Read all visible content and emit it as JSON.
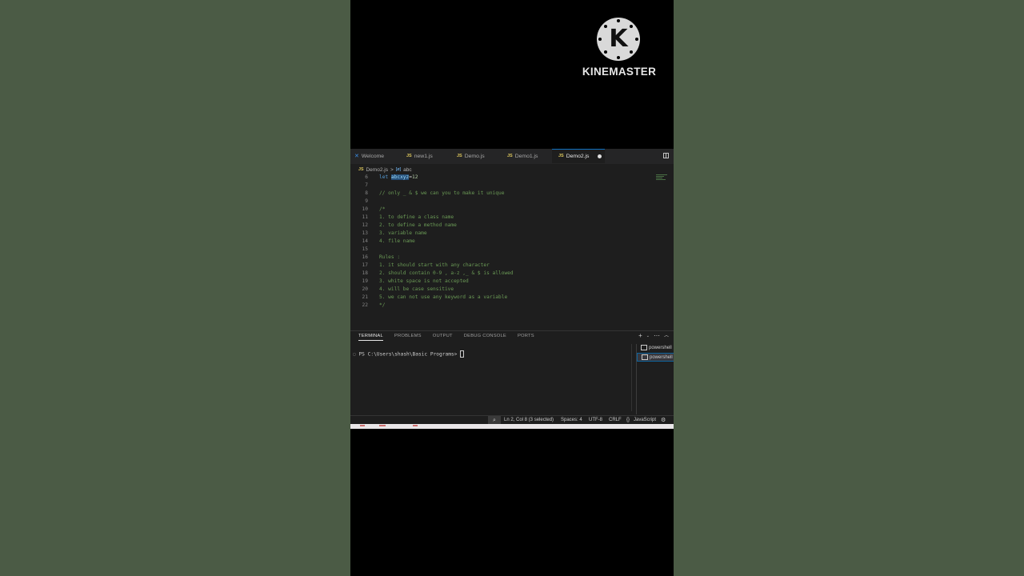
{
  "watermark": {
    "brand": "KINEMASTER",
    "logo_letter": "K"
  },
  "tabs": [
    {
      "icon": "vscode-icon",
      "label": "Welcome",
      "active": false
    },
    {
      "icon": "JS",
      "label": "new1.js",
      "active": false
    },
    {
      "icon": "JS",
      "label": "Demo.js",
      "active": false
    },
    {
      "icon": "JS",
      "label": "Demo1.js",
      "active": false
    },
    {
      "icon": "JS",
      "label": "Demo2.js",
      "active": true,
      "modified": true
    }
  ],
  "breadcrumb": {
    "file": "Demo2.js",
    "sep": ">",
    "symbol_icon": "[ø]",
    "symbol": "abc"
  },
  "editor": {
    "lines": [
      {
        "n": "6",
        "text": "let abcxyz=12"
      },
      {
        "n": "7",
        "text": ""
      },
      {
        "n": "8",
        "text": "// only _ & $ we can you to make it unique"
      },
      {
        "n": "9",
        "text": ""
      },
      {
        "n": "10",
        "text": "/*"
      },
      {
        "n": "11",
        "text": "1. to define a class name"
      },
      {
        "n": "12",
        "text": "2. to define a method name"
      },
      {
        "n": "13",
        "text": "3. variable name"
      },
      {
        "n": "14",
        "text": "4. file name"
      },
      {
        "n": "15",
        "text": ""
      },
      {
        "n": "16",
        "text": "Rules :"
      },
      {
        "n": "17",
        "text": "1. it should start with any character"
      },
      {
        "n": "18",
        "text": "2. should contain 0-9 , a-z ,_ & $ is allowed"
      },
      {
        "n": "19",
        "text": "3. white space is not accepted"
      },
      {
        "n": "20",
        "text": "4. will be case sensitive"
      },
      {
        "n": "21",
        "text": "5. we can not use any keyword as a variable"
      },
      {
        "n": "22",
        "text": "*/"
      }
    ]
  },
  "panel": {
    "tabs": [
      "TERMINAL",
      "PROBLEMS",
      "OUTPUT",
      "DEBUG CONSOLE",
      "PORTS"
    ],
    "active_tab": "TERMINAL",
    "prompt": "PS C:\\Users\\shash\\Basic Programs> ",
    "terminals": [
      "powershell",
      "powershell"
    ]
  },
  "status": {
    "position": "Ln 2, Col 8 (3 selected)",
    "spaces": "Spaces: 4",
    "encoding": "UTF-8",
    "eol": "CRLF",
    "language": "JavaScript",
    "lang_icon": "{}"
  }
}
